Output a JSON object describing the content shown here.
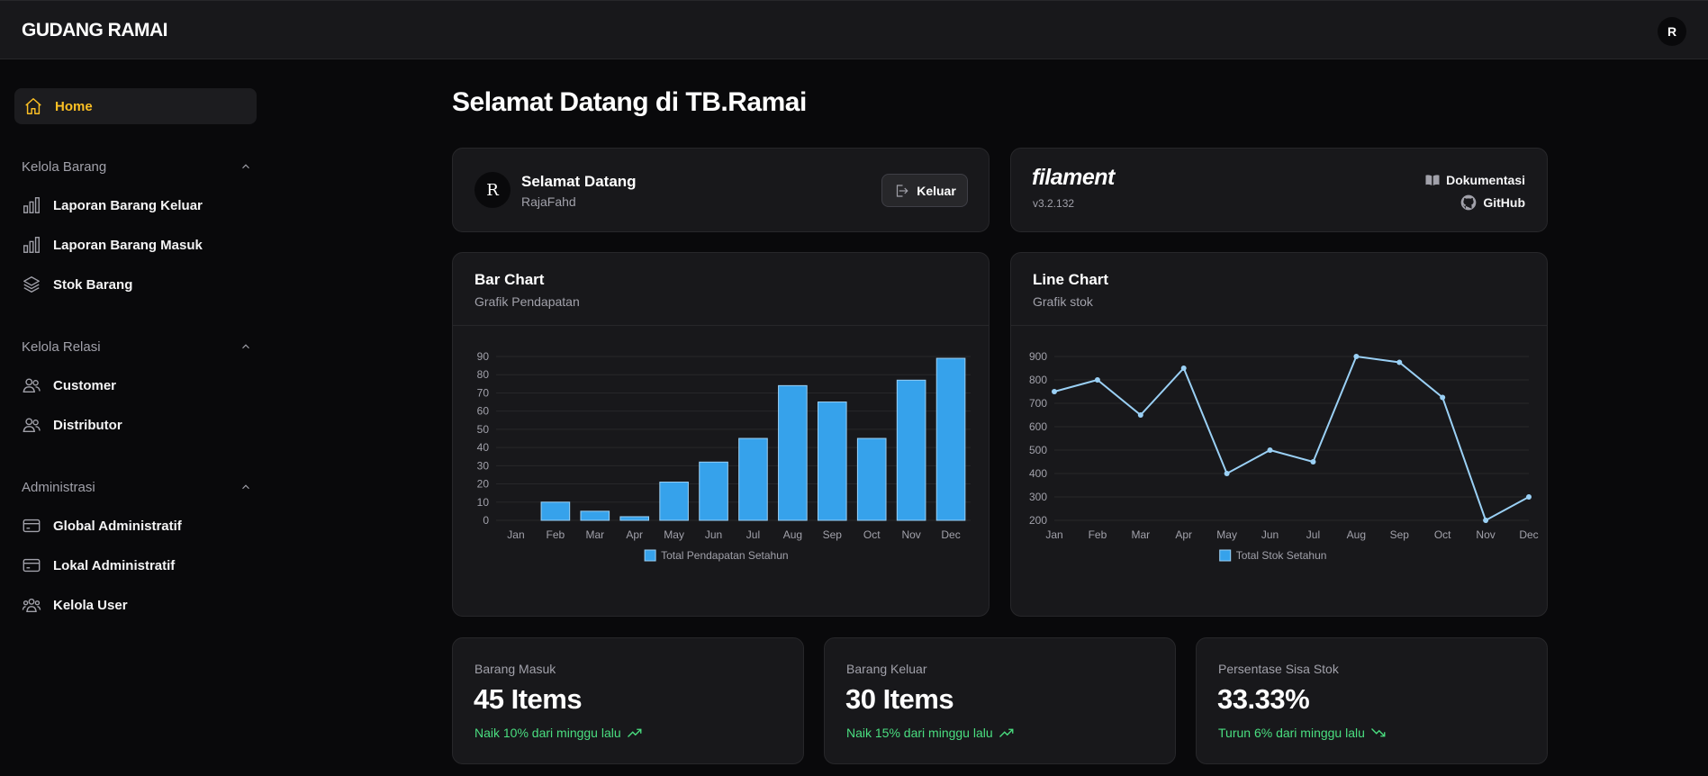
{
  "app": {
    "brand": "GUDANG RAMAI",
    "user_initial": "R"
  },
  "sidebar": {
    "home": "Home",
    "groups": [
      {
        "title": "Kelola Barang",
        "items": [
          "Laporan Barang Keluar",
          "Laporan Barang Masuk",
          "Stok Barang"
        ]
      },
      {
        "title": "Kelola Relasi",
        "items": [
          "Customer",
          "Distributor"
        ]
      },
      {
        "title": "Administrasi",
        "items": [
          "Global Administratif",
          "Lokal Administratif",
          "Kelola User"
        ]
      }
    ]
  },
  "page": {
    "title": "Selamat Datang di TB.Ramai"
  },
  "welcome": {
    "avatar": "R",
    "title": "Selamat Datang",
    "username": "RajaFahd",
    "logout": "Keluar"
  },
  "filament": {
    "logo": "filament",
    "version": "v3.2.132",
    "docs": "Dokumentasi",
    "github": "GitHub"
  },
  "bar_widget": {
    "title": "Bar Chart",
    "subtitle": "Grafik Pendapatan"
  },
  "line_widget": {
    "title": "Line Chart",
    "subtitle": "Grafik stok"
  },
  "stats": [
    {
      "label": "Barang Masuk",
      "value": "45 Items",
      "desc": "Naik 10% dari minggu lalu",
      "trend": "up"
    },
    {
      "label": "Barang Keluar",
      "value": "30 Items",
      "desc": "Naik 15% dari minggu lalu",
      "trend": "up"
    },
    {
      "label": "Persentase Sisa Stok",
      "value": "33.33%",
      "desc": "Turun 6% dari minggu lalu",
      "trend": "down"
    }
  ],
  "colors": {
    "accent": "#fbbf24",
    "bar": "#36a2eb",
    "line": "#9ad0f5",
    "success": "#4ade80"
  },
  "chart_data": [
    {
      "type": "bar",
      "categories": [
        "Jan",
        "Feb",
        "Mar",
        "Apr",
        "May",
        "Jun",
        "Jul",
        "Aug",
        "Sep",
        "Oct",
        "Nov",
        "Dec"
      ],
      "series": [
        {
          "name": "Total Pendapatan Setahun",
          "values": [
            0,
            10,
            5,
            2,
            21,
            32,
            45,
            74,
            65,
            45,
            77,
            89
          ]
        }
      ],
      "ylim": [
        0,
        90
      ],
      "yticks": [
        0,
        10,
        20,
        30,
        40,
        50,
        60,
        70,
        80,
        90
      ],
      "grid": true,
      "legend": "bottom"
    },
    {
      "type": "line",
      "categories": [
        "Jan",
        "Feb",
        "Mar",
        "Apr",
        "May",
        "Jun",
        "Jul",
        "Aug",
        "Sep",
        "Oct",
        "Nov",
        "Dec"
      ],
      "series": [
        {
          "name": "Total Stok Setahun",
          "values": [
            750,
            800,
            650,
            850,
            400,
            500,
            450,
            900,
            875,
            725,
            200,
            300
          ]
        }
      ],
      "ylim": [
        200,
        900
      ],
      "yticks": [
        200,
        300,
        400,
        500,
        600,
        700,
        800,
        900
      ],
      "grid": true,
      "legend": "bottom"
    }
  ]
}
